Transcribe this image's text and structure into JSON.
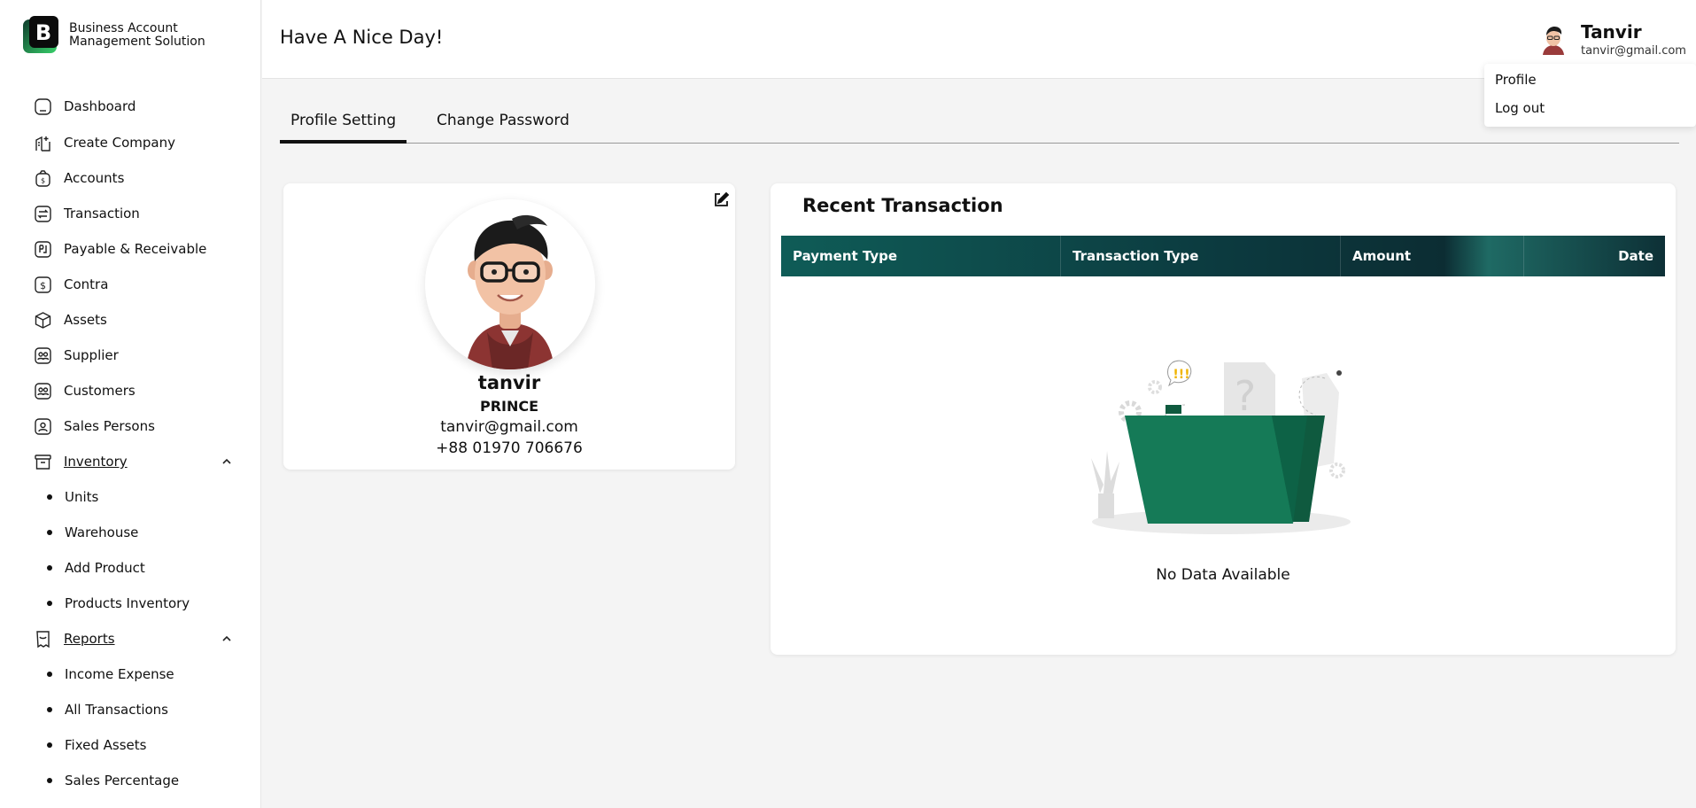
{
  "brand": {
    "line1": "Business Account",
    "line2": "Management Solution",
    "accent": "#1fae5b"
  },
  "sidebar": {
    "items": [
      {
        "label": "Dashboard",
        "icon": "home-icon"
      },
      {
        "label": "Create Company",
        "icon": "building-plus-icon"
      },
      {
        "label": "Accounts",
        "icon": "money-bag-icon"
      },
      {
        "label": "Transaction",
        "icon": "exchange-icon"
      },
      {
        "label": "Payable & Receivable",
        "icon": "payable-icon"
      },
      {
        "label": "Contra",
        "icon": "dollar-icon"
      },
      {
        "label": "Assets",
        "icon": "cube-icon"
      },
      {
        "label": "Supplier",
        "icon": "users-icon"
      },
      {
        "label": "Customers",
        "icon": "users-icon"
      },
      {
        "label": "Sales Persons",
        "icon": "user-badge-icon"
      }
    ],
    "inventory": {
      "label": "Inventory",
      "icon": "archive-icon",
      "expanded": true,
      "items": [
        "Units",
        "Warehouse",
        "Add Product",
        "Products Inventory"
      ]
    },
    "reports": {
      "label": "Reports",
      "icon": "receipt-icon",
      "expanded": true,
      "items": [
        "Income Expense",
        "All Transactions",
        "Fixed Assets",
        "Sales Percentage"
      ]
    }
  },
  "header": {
    "greeting": "Have A Nice Day!",
    "user_name": "Tanvir",
    "user_email": "tanvir@gmail.com"
  },
  "user_menu": {
    "items": [
      "Profile",
      "Log out"
    ]
  },
  "tabs": [
    {
      "label": "Profile Setting",
      "active": true
    },
    {
      "label": "Change Password",
      "active": false
    }
  ],
  "profile": {
    "name": "tanvir",
    "role": "PRINCE",
    "email": "tanvir@gmail.com",
    "phone": "+88 01970 706676"
  },
  "transactions": {
    "title": "Recent Transaction",
    "columns": [
      "Payment Type",
      "Transaction Type",
      "Amount",
      "Date"
    ],
    "rows": [],
    "empty_text": "No Data Available",
    "header_color": "#0c3a3f",
    "folder_color": "#157a57"
  }
}
